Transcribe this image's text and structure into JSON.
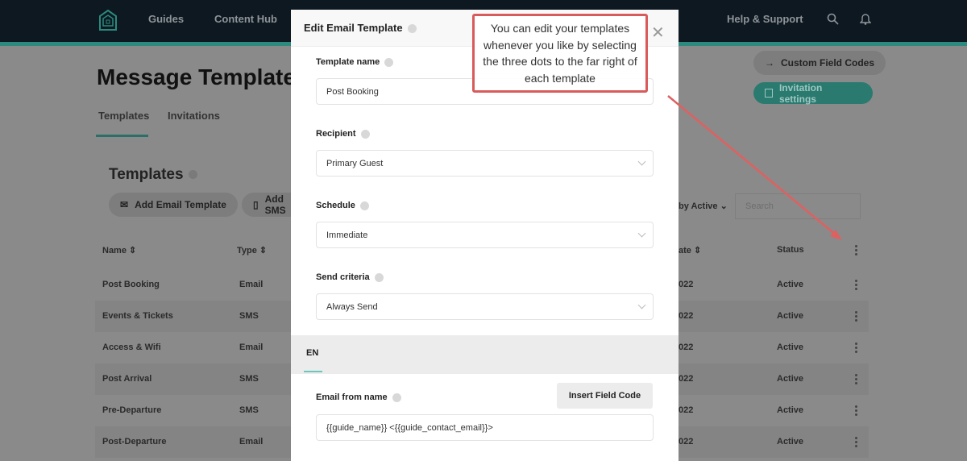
{
  "nav": {
    "items": [
      "Guides",
      "Content Hub"
    ],
    "help": "Help & Support"
  },
  "page": {
    "title": "Message Templates",
    "tabs": [
      "Templates",
      "Invitations"
    ],
    "custom_field_codes": "Custom Field Codes",
    "invitation_settings": "Invitation settings"
  },
  "templates": {
    "heading": "Templates",
    "add_email": "Add Email Template",
    "add_sms": "Add SMS",
    "filter": "by Active",
    "search_placeholder": "Search",
    "columns": [
      "Name",
      "Type",
      "ate",
      "Status"
    ],
    "rows": [
      {
        "name": "Post Booking",
        "type": "Email",
        "date": "022",
        "status": "Active"
      },
      {
        "name": "Events & Tickets",
        "type": "SMS",
        "date": "022",
        "status": "Active"
      },
      {
        "name": "Access & Wifi",
        "type": "Email",
        "date": "022",
        "status": "Active"
      },
      {
        "name": "Post Arrival",
        "type": "SMS",
        "date": "022",
        "status": "Active"
      },
      {
        "name": "Pre-Departure",
        "type": "SMS",
        "date": "022",
        "status": "Active"
      },
      {
        "name": "Post-Departure",
        "type": "Email",
        "date": "022",
        "status": "Active"
      }
    ]
  },
  "modal": {
    "title": "Edit Email Template",
    "template_name_label": "Template name",
    "template_name": "Post Booking",
    "recipient_label": "Recipient",
    "recipient": "Primary Guest",
    "schedule_label": "Schedule",
    "schedule": "Immediate",
    "criteria_label": "Send criteria",
    "criteria": "Always Send",
    "lang": "EN",
    "from_label": "Email from name",
    "insert": "Insert Field Code",
    "from_value": "{{guide_name}} <{{guide_contact_email}}>"
  },
  "callout": "You can edit your templates whenever you like by selecting the three dots to the far right of each template",
  "colors": {
    "accent": "#2c8a7f",
    "annotation": "#d95a5a",
    "header": "#0d1820"
  }
}
